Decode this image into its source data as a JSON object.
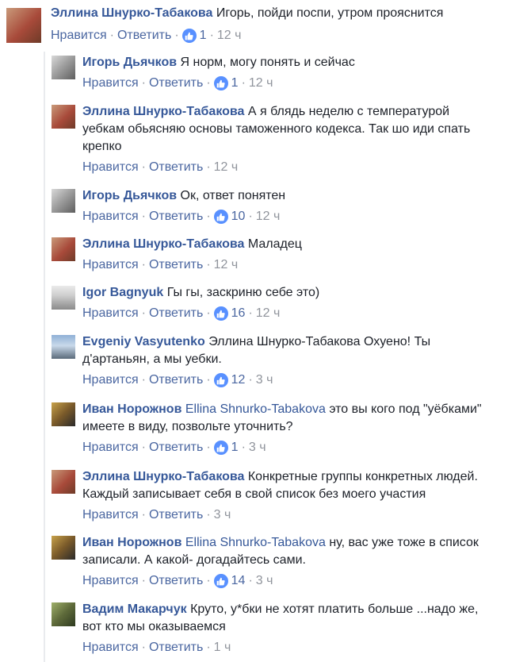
{
  "actions": {
    "like": "Нравится",
    "reply": "Ответить"
  },
  "comments": [
    {
      "author": "Эллина Шнурко-Табакова",
      "mention": "",
      "text": "Игорь, пойди поспи, утром прояснится",
      "text2": "",
      "likes": "1",
      "time": "12 ч"
    },
    {
      "author": "Игорь Дьячков",
      "mention": "",
      "text": "Я норм, могу понять и сейчас",
      "text2": "",
      "likes": "1",
      "time": "12 ч"
    },
    {
      "author": "Эллина Шнурко-Табакова",
      "mention": "",
      "text": "А я блядь неделю с температурой",
      "text2": "уебкам обьясняю основы таможенного кодекса. Так шо иди спать",
      "text3": "крепко",
      "likes": "",
      "time": "12 ч"
    },
    {
      "author": "Игорь Дьячков",
      "mention": "",
      "text": "Ок, ответ понятен",
      "text2": "",
      "likes": "10",
      "time": "12 ч"
    },
    {
      "author": "Эллина Шнурко-Табакова",
      "mention": "",
      "text": "Маладец",
      "text2": "",
      "likes": "",
      "time": "12 ч"
    },
    {
      "author": "Igor Bagnyuk",
      "mention": "",
      "text": "Гы гы, заскриню себе это)",
      "text2": "",
      "likes": "16",
      "time": "12 ч"
    },
    {
      "author": "Evgeniy Vasyutenko",
      "mention": "",
      "text": "Эллина Шнурко-Табакова Охуено! Ты",
      "text2": "д'артаньян, а мы уебки.",
      "likes": "12",
      "time": "3 ч"
    },
    {
      "author": "Иван Норожнов",
      "mention": "Ellina Shnurko-Tabakova",
      "text": "это вы кого под \"уёбками\"",
      "text2": "имеете в виду, позвольте уточнить?",
      "likes": "1",
      "time": "3 ч"
    },
    {
      "author": "Эллина Шнурко-Табакова",
      "mention": "",
      "text": "Конкретные группы конкретных людей.",
      "text2": "Каждый записывает себя в свой список без моего участия",
      "likes": "",
      "time": "3 ч"
    },
    {
      "author": "Иван Норожнов",
      "mention": "Ellina Shnurko-Tabakova",
      "text": "ну, вас уже тоже в список",
      "text2": "записали. А какой- догадайтесь сами.",
      "likes": "14",
      "time": "3 ч"
    },
    {
      "author": "Вадим Макарчук",
      "mention": "",
      "text": "Круто, у*бки не хотят платить больше ...надо же,",
      "text2": "вот кто мы оказываемся",
      "likes": "",
      "time": "1 ч"
    }
  ]
}
